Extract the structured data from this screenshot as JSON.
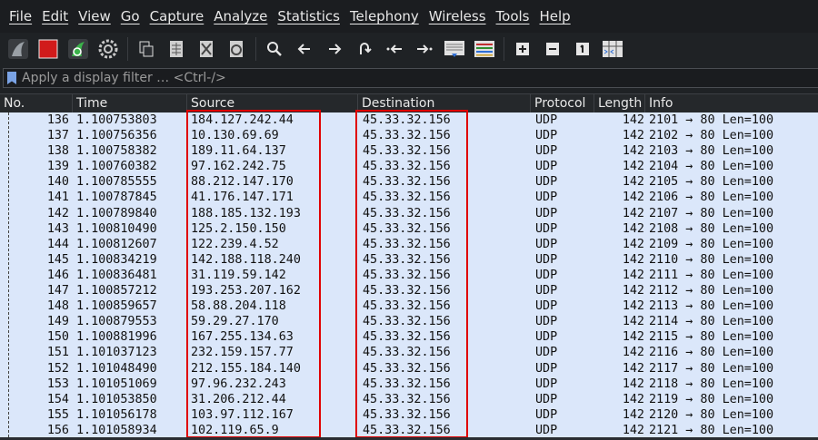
{
  "menu": [
    "File",
    "Edit",
    "View",
    "Go",
    "Capture",
    "Analyze",
    "Statistics",
    "Telephony",
    "Wireless",
    "Tools",
    "Help"
  ],
  "toolbar": {
    "icons": [
      "shark-fin-start-icon",
      "stop-square-icon",
      "restart-capture-icon",
      "capture-options-gear-icon",
      "open-file-icon",
      "save-file-icon",
      "close-file-icon",
      "reload-file-icon",
      "find-packet-icon",
      "go-back-arrow-icon",
      "go-forward-arrow-icon",
      "go-to-packet-icon",
      "first-packet-icon",
      "last-packet-icon",
      "auto-scroll-icon",
      "colorize-icon",
      "zoom-in-icon",
      "zoom-out-icon",
      "normal-size-icon",
      "resize-columns-icon"
    ],
    "colors": {
      "stop": "#d11b1b",
      "shark": "#3bb34a"
    }
  },
  "filter": {
    "placeholder": "Apply a display filter … <Ctrl-/>"
  },
  "columns": {
    "no": "No.",
    "time": "Time",
    "source": "Source",
    "destination": "Destination",
    "protocol": "Protocol",
    "length": "Length",
    "info": "Info"
  },
  "packets": [
    {
      "no": "136",
      "time": "1.100753803",
      "source": "184.127.242.44",
      "destination": "45.33.32.156",
      "protocol": "UDP",
      "length": "142",
      "info": "2101 → 80 Len=100"
    },
    {
      "no": "137",
      "time": "1.100756356",
      "source": "10.130.69.69",
      "destination": "45.33.32.156",
      "protocol": "UDP",
      "length": "142",
      "info": "2102 → 80 Len=100"
    },
    {
      "no": "138",
      "time": "1.100758382",
      "source": "189.11.64.137",
      "destination": "45.33.32.156",
      "protocol": "UDP",
      "length": "142",
      "info": "2103 → 80 Len=100"
    },
    {
      "no": "139",
      "time": "1.100760382",
      "source": "97.162.242.75",
      "destination": "45.33.32.156",
      "protocol": "UDP",
      "length": "142",
      "info": "2104 → 80 Len=100"
    },
    {
      "no": "140",
      "time": "1.100785555",
      "source": "88.212.147.170",
      "destination": "45.33.32.156",
      "protocol": "UDP",
      "length": "142",
      "info": "2105 → 80 Len=100"
    },
    {
      "no": "141",
      "time": "1.100787845",
      "source": "41.176.147.171",
      "destination": "45.33.32.156",
      "protocol": "UDP",
      "length": "142",
      "info": "2106 → 80 Len=100"
    },
    {
      "no": "142",
      "time": "1.100789840",
      "source": "188.185.132.193",
      "destination": "45.33.32.156",
      "protocol": "UDP",
      "length": "142",
      "info": "2107 → 80 Len=100"
    },
    {
      "no": "143",
      "time": "1.100810490",
      "source": "125.2.150.150",
      "destination": "45.33.32.156",
      "protocol": "UDP",
      "length": "142",
      "info": "2108 → 80 Len=100"
    },
    {
      "no": "144",
      "time": "1.100812607",
      "source": "122.239.4.52",
      "destination": "45.33.32.156",
      "protocol": "UDP",
      "length": "142",
      "info": "2109 → 80 Len=100"
    },
    {
      "no": "145",
      "time": "1.100834219",
      "source": "142.188.118.240",
      "destination": "45.33.32.156",
      "protocol": "UDP",
      "length": "142",
      "info": "2110 → 80 Len=100"
    },
    {
      "no": "146",
      "time": "1.100836481",
      "source": "31.119.59.142",
      "destination": "45.33.32.156",
      "protocol": "UDP",
      "length": "142",
      "info": "2111 → 80 Len=100"
    },
    {
      "no": "147",
      "time": "1.100857212",
      "source": "193.253.207.162",
      "destination": "45.33.32.156",
      "protocol": "UDP",
      "length": "142",
      "info": "2112 → 80 Len=100"
    },
    {
      "no": "148",
      "time": "1.100859657",
      "source": "58.88.204.118",
      "destination": "45.33.32.156",
      "protocol": "UDP",
      "length": "142",
      "info": "2113 → 80 Len=100"
    },
    {
      "no": "149",
      "time": "1.100879553",
      "source": "59.29.27.170",
      "destination": "45.33.32.156",
      "protocol": "UDP",
      "length": "142",
      "info": "2114 → 80 Len=100"
    },
    {
      "no": "150",
      "time": "1.100881996",
      "source": "167.255.134.63",
      "destination": "45.33.32.156",
      "protocol": "UDP",
      "length": "142",
      "info": "2115 → 80 Len=100"
    },
    {
      "no": "151",
      "time": "1.101037123",
      "source": "232.159.157.77",
      "destination": "45.33.32.156",
      "protocol": "UDP",
      "length": "142",
      "info": "2116 → 80 Len=100"
    },
    {
      "no": "152",
      "time": "1.101048490",
      "source": "212.155.184.140",
      "destination": "45.33.32.156",
      "protocol": "UDP",
      "length": "142",
      "info": "2117 → 80 Len=100"
    },
    {
      "no": "153",
      "time": "1.101051069",
      "source": "97.96.232.243",
      "destination": "45.33.32.156",
      "protocol": "UDP",
      "length": "142",
      "info": "2118 → 80 Len=100"
    },
    {
      "no": "154",
      "time": "1.101053850",
      "source": "31.206.212.44",
      "destination": "45.33.32.156",
      "protocol": "UDP",
      "length": "142",
      "info": "2119 → 80 Len=100"
    },
    {
      "no": "155",
      "time": "1.101056178",
      "source": "103.97.112.167",
      "destination": "45.33.32.156",
      "protocol": "UDP",
      "length": "142",
      "info": "2120 → 80 Len=100"
    },
    {
      "no": "156",
      "time": "1.101058934",
      "source": "102.119.65.9",
      "destination": "45.33.32.156",
      "protocol": "UDP",
      "length": "142",
      "info": "2121 → 80 Len=100"
    }
  ],
  "row_background": "#dbe7fa",
  "highlight_color": "#e00000"
}
